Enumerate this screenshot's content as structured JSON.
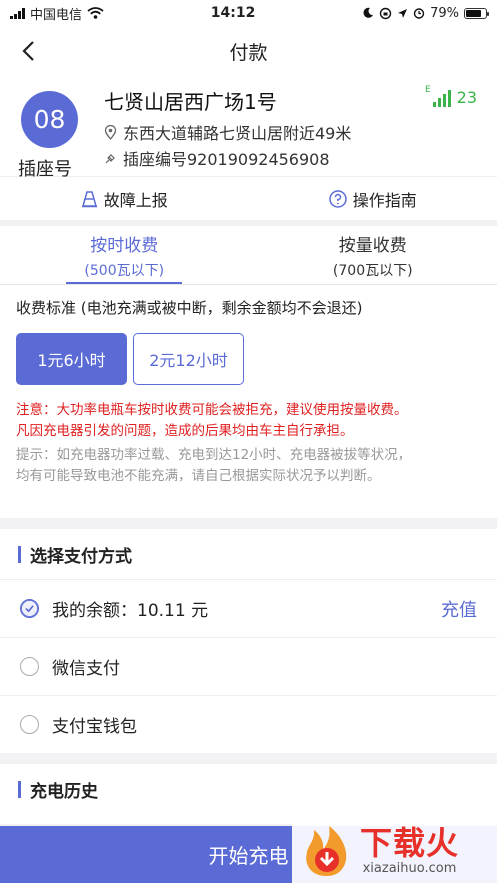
{
  "status_bar": {
    "carrier": "中国电信",
    "time": "14:12",
    "battery": "79%",
    "battery_level": 0.79
  },
  "nav": {
    "title": "付款"
  },
  "station": {
    "number": "08",
    "number_label": "插座号",
    "name": "七贤山居西广场1号",
    "signal_letter": "E",
    "signal_value": "23",
    "address": "东西大道辅路七贤山居附近49米",
    "socket_id": "插座编号92019092456908"
  },
  "actions": {
    "report": "故障上报",
    "guide": "操作指南"
  },
  "tabs": [
    {
      "label": "按时收费",
      "sub": "(500瓦以下)"
    },
    {
      "label": "按量收费",
      "sub": "(700瓦以下)"
    }
  ],
  "fee": {
    "standard": "收费标准 (电池充满或被中断，剩余金额均不会退还)",
    "options": [
      "1元6小时",
      "2元12小时"
    ],
    "notice_line1": "注意：大功率电瓶车按时收费可能会被拒充，建议使用按量收费。",
    "notice_line2": "凡因充电器引发的问题，造成的后果均由车主自行承担。",
    "tip_line1": "提示：如充电器功率过载、充电到达12小时、充电器被拔等状况，",
    "tip_line2": "均有可能导致电池不能充满，请自己根据实际状况予以判断。"
  },
  "payment": {
    "title": "选择支付方式",
    "balance": "我的余额：10.11 元",
    "recharge": "充值",
    "wechat": "微信支付",
    "alipay": "支付宝钱包"
  },
  "history": {
    "title": "充电历史"
  },
  "bottom": {
    "start": "开始充电"
  },
  "watermark": {
    "brand": "下载火",
    "domain": "xiazaihuo.com"
  },
  "colors": {
    "accent": "#5b6bd6",
    "warning": "#e02020",
    "signal": "#3ab44a",
    "brand_red": "#e8302a"
  }
}
